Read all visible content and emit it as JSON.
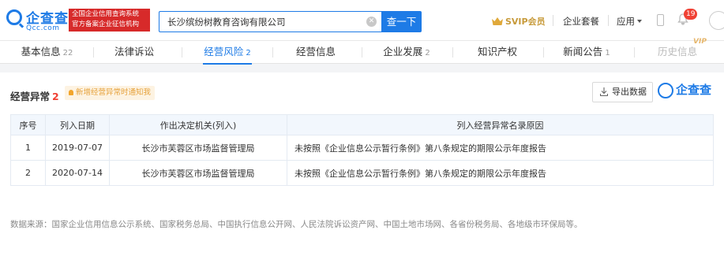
{
  "header": {
    "logo_text": "企查查",
    "logo_domain": "Qcc.com",
    "gov_badge_line1": "全国企业信用查询系统",
    "gov_badge_line2": "官方备案企业征信机构",
    "search_value": "长沙缤纷树教育咨询有限公司",
    "search_button": "查一下",
    "svip_label": "SVIP会员",
    "nav_package": "企业套餐",
    "nav_apps": "应用",
    "notification_count": "19"
  },
  "tabs": [
    {
      "label": "基本信息",
      "count": "22"
    },
    {
      "label": "法律诉讼",
      "count": ""
    },
    {
      "label": "经营风险",
      "count": "2"
    },
    {
      "label": "经营信息",
      "count": ""
    },
    {
      "label": "企业发展",
      "count": "2"
    },
    {
      "label": "知识产权",
      "count": ""
    },
    {
      "label": "新闻公告",
      "count": "1"
    },
    {
      "label": "历史信息",
      "count": ""
    }
  ],
  "vip_tag": "VIP",
  "section": {
    "title": "经营异常",
    "count": "2",
    "tip": "新增经营异常时通知我",
    "export_label": "导出数据",
    "brand_text": "企查查"
  },
  "table": {
    "headers": [
      "序号",
      "列入日期",
      "作出决定机关(列入)",
      "列入经营异常名录原因"
    ],
    "rows": [
      [
        "1",
        "2019-07-07",
        "长沙市芙蓉区市场监督管理局",
        "未按照《企业信息公示暂行条例》第八条规定的期限公示年度报告"
      ],
      [
        "2",
        "2020-07-14",
        "长沙市芙蓉区市场监督管理局",
        "未按照《企业信息公示暂行条例》第八条规定的期限公示年度报告"
      ]
    ]
  },
  "footer_note": "数据来源：国家企业信用信息公示系统、国家税务总局、中国执行信息公开网、人民法院诉讼资产网、中国土地市场网、各省份税务局、各地级市环保局等。",
  "colors": {
    "brand_blue": "#1e7be6",
    "alert_red": "#f04134",
    "gov_badge_red": "#d72a2a",
    "tip_orange": "#e6a23c",
    "svip_gold": "#c79a3a"
  }
}
